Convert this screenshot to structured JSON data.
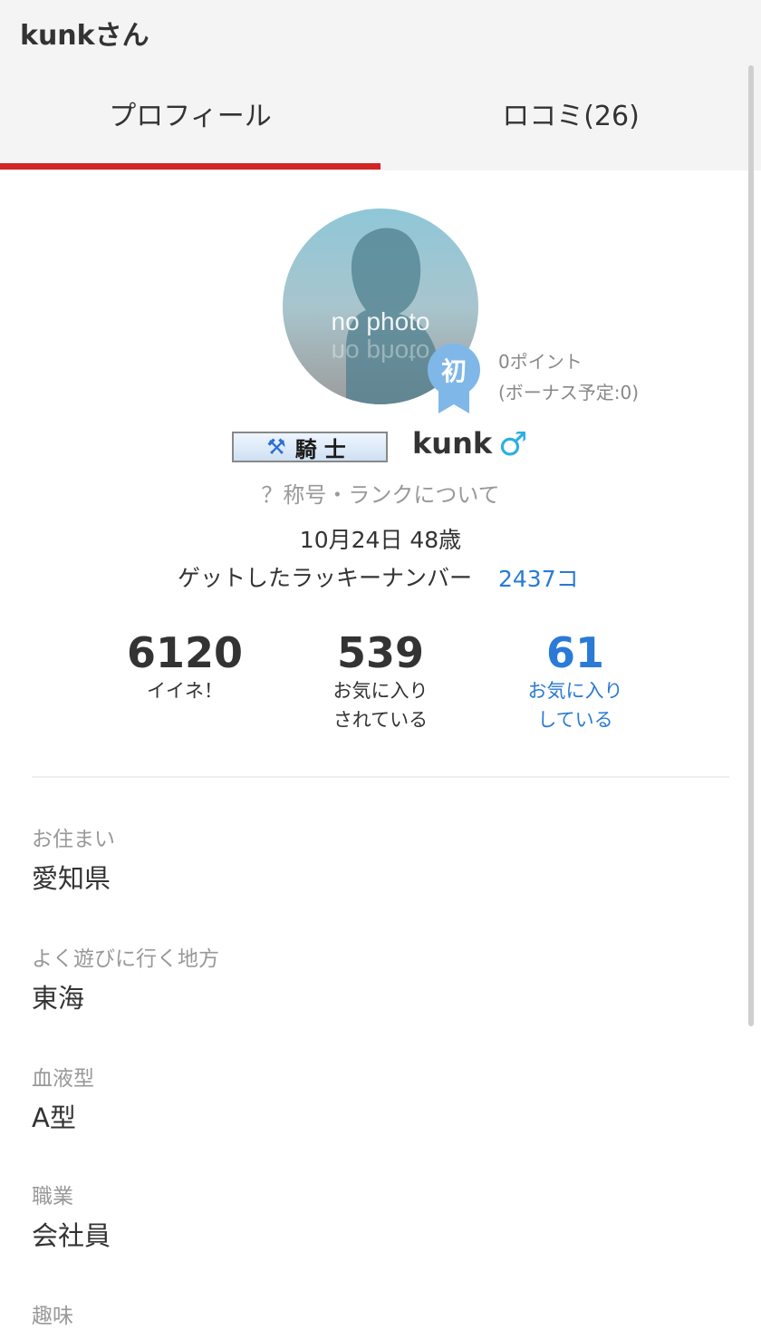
{
  "header": {
    "title": "kunkさん"
  },
  "tabs": [
    {
      "label": "プロフィール",
      "active": true
    },
    {
      "label": "ロコミ(26)",
      "active": false
    }
  ],
  "colors": {
    "accent": "#d42323",
    "link": "#2a7ad6",
    "gender": "#2ab0e0",
    "badge": "#7fb7e8"
  },
  "profile": {
    "avatar_text": "no photo",
    "badge_text": "初",
    "points": "0ポイント",
    "bonus": "(ボーナス予定:0)",
    "rank_title": "騎士",
    "rank_icon": "crossed-axes-icon",
    "username": "kunk",
    "gender_symbol": "♂",
    "rank_link": "？称号・ランクについて",
    "birthday": "10月24日 48歳",
    "lucky_label": "ゲットしたラッキーナンバー",
    "lucky_value": "2437コ"
  },
  "stats": [
    {
      "number": "6120",
      "label1": "イイネ！",
      "label2": ""
    },
    {
      "number": "539",
      "label1": "お気に入り",
      "label2": "されている"
    },
    {
      "number": "61",
      "label1": "お気に入り",
      "label2": "している"
    }
  ],
  "fields": [
    {
      "label": "お住まい",
      "value": "愛知県"
    },
    {
      "label": "よく遊びに行く地方",
      "value": "東海"
    },
    {
      "label": "血液型",
      "value": "A型"
    },
    {
      "label": "職業",
      "value": "会社員"
    },
    {
      "label": "趣味",
      "value": ""
    }
  ]
}
